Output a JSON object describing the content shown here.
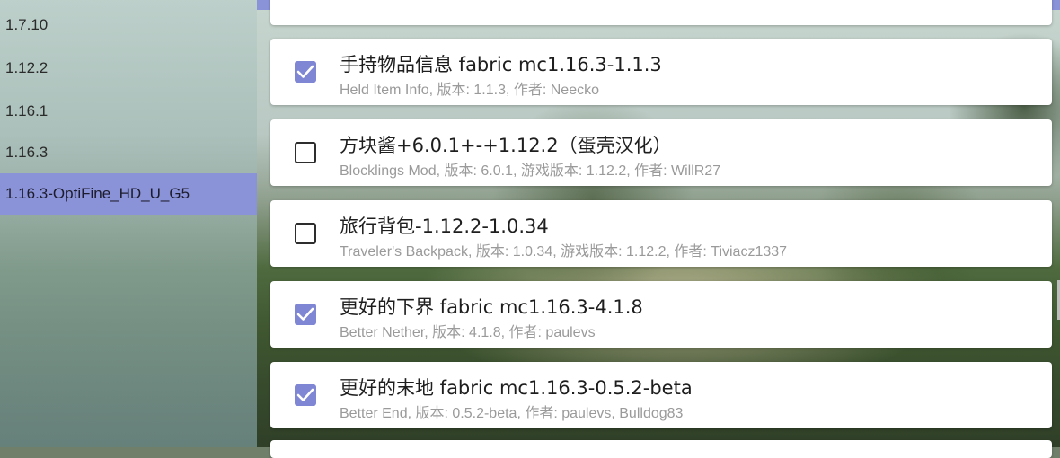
{
  "sidebar": {
    "items": [
      {
        "label": "1.7.10",
        "active": false
      },
      {
        "label": "1.12.2",
        "active": false
      },
      {
        "label": "1.16.1",
        "active": false
      },
      {
        "label": "1.16.3",
        "active": false
      },
      {
        "label": "1.16.3-OptiFine_HD_U_G5",
        "active": true
      }
    ]
  },
  "mods": {
    "items": [
      {
        "title": "手持物品信息 fabric mc1.16.3-1.1.3",
        "subtitle": "Held Item Info, 版本: 1.1.3, 作者: Neecko",
        "checked": true
      },
      {
        "title": "方块酱+6.0.1+-+1.12.2（蛋壳汉化）",
        "subtitle": "Blocklings Mod, 版本: 6.0.1, 游戏版本: 1.12.2, 作者: WillR27",
        "checked": false
      },
      {
        "title": "旅行背包-1.12.2-1.0.34",
        "subtitle": "Traveler's Backpack, 版本: 1.0.34, 游戏版本: 1.12.2, 作者: Tiviacz1337",
        "checked": false
      },
      {
        "title": "更好的下界 fabric mc1.16.3-4.1.8",
        "subtitle": "Better Nether, 版本: 4.1.8, 作者: paulevs",
        "checked": true
      },
      {
        "title": "更好的末地 fabric mc1.16.3-0.5.2-beta",
        "subtitle": "Better End, 版本: 0.5.2-beta, 作者: paulevs, Bulldog83",
        "checked": true
      }
    ]
  },
  "colors": {
    "accent": "#8a92d8",
    "checkbox_on": "#7f86d4"
  },
  "icons": {
    "check": "check-icon"
  }
}
